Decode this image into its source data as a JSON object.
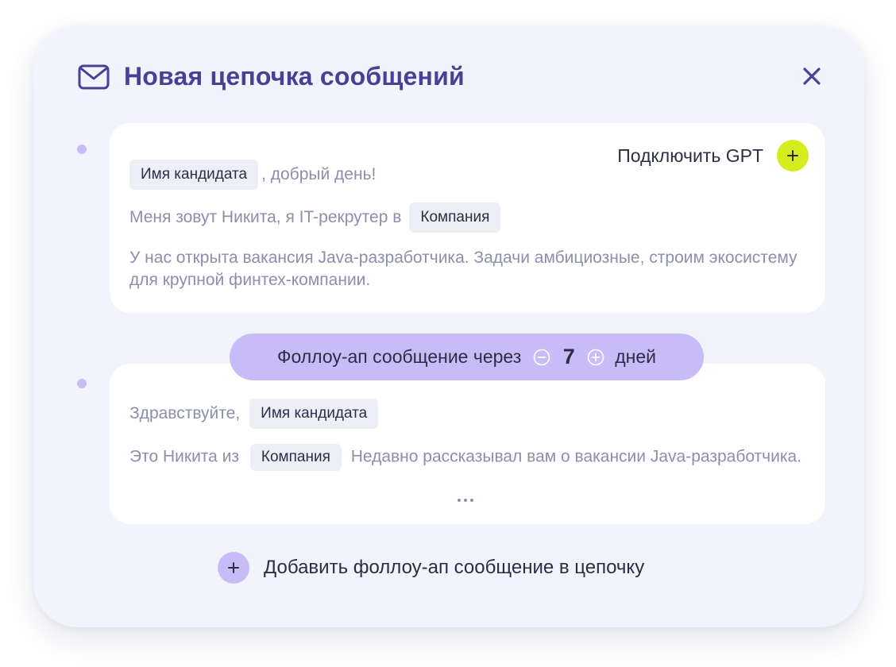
{
  "modal": {
    "title": "Новая цепочка сообщений",
    "icons": {
      "header": "mail-icon",
      "close": "close-icon"
    }
  },
  "message1": {
    "gpt_label": "Подключить GPT",
    "candidate_chip": "Имя кандидата",
    "greeting_suffix": ", добрый день!",
    "intro": "Меня зовут Никита, я IT-рекрутер в",
    "company_chip": "Компания",
    "body": "У нас открыта вакансия Java-разработчика. Задачи амбициозные, строим экосистему для крупной финтех-компании."
  },
  "followup": {
    "prefix": "Фоллоу-ап сообщение через",
    "days_value": "7",
    "suffix": "дней"
  },
  "message2": {
    "greeting": "Здравствуйте,",
    "candidate_chip": "Имя кандидата",
    "line_prefix": "Это Никита из",
    "company_chip": "Компания",
    "line_suffix": "Недавно рассказывал вам о вакансии Java-разработчика."
  },
  "add_button": {
    "label": "Добавить фоллоу-ап сообщение в цепочку"
  },
  "colors": {
    "panel_bg": "#f1f4fd",
    "title": "#4a3f96",
    "accent_lavender": "#c8bcf8",
    "gpt_lime": "#d6ec1f",
    "chip_bg": "#eceff6",
    "muted_text": "#8c8fac"
  }
}
